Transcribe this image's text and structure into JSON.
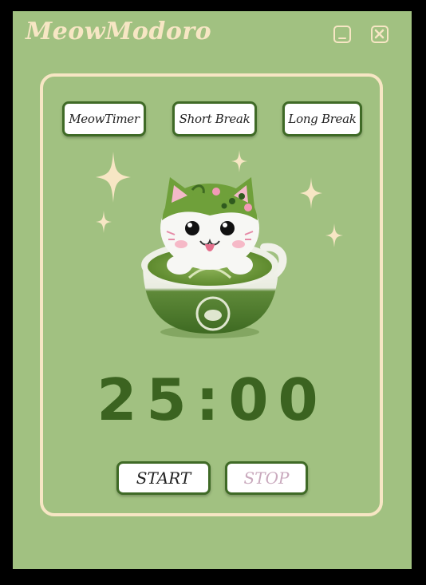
{
  "app": {
    "title": "MeowModoro"
  },
  "window_controls": {
    "minimize_icon": "minimize-icon",
    "close_icon": "close-icon"
  },
  "modes": [
    {
      "label": "MeowTimer"
    },
    {
      "label": "Short Break"
    },
    {
      "label": "Long Break"
    }
  ],
  "mascot": {
    "icon": "matcha-cat-cup-illustration"
  },
  "timer": {
    "display": "25:00"
  },
  "controls": {
    "start_label": "START",
    "stop_label": "STOP"
  },
  "colors": {
    "background": "#a1c181",
    "cream": "#f7e6c4",
    "dark_green": "#3b6320",
    "stop_text": "#c9a9bd"
  }
}
